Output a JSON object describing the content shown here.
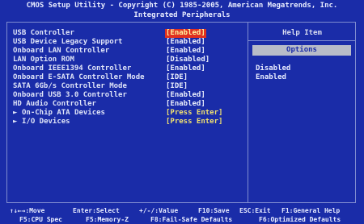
{
  "header": {
    "title": "CMOS Setup Utility - Copyright (C) 1985-2005, American Megatrends, Inc.",
    "subtitle": "Integrated Peripherals"
  },
  "settings": [
    {
      "label": "USB Controller",
      "value": "[Enabled]",
      "selected": true
    },
    {
      "label": "USB Device Legacy Support",
      "value": "[Enabled]"
    },
    {
      "label": "Onboard LAN Controller",
      "value": "[Enabled]"
    },
    {
      "label": "LAN Option ROM",
      "value": "[Disabled]"
    },
    {
      "label": "Onboard IEEE1394 Controller",
      "value": "[Enabled]"
    },
    {
      "label": "Onboard E-SATA Controller Mode",
      "value": "[IDE]"
    },
    {
      "label": "SATA 6Gb/s Controller Mode",
      "value": "[IDE]"
    },
    {
      "label": "Onboard USB 3.0 Controller",
      "value": "[Enabled]"
    },
    {
      "label": "HD Audio Controller",
      "value": "[Enabled]"
    },
    {
      "label": "On-Chip ATA Devices",
      "value": "[Press Enter]",
      "submenu": true
    },
    {
      "label": "I/O Devices",
      "value": "[Press Enter]",
      "submenu": true
    }
  ],
  "help": {
    "title": "Help Item",
    "options_label": "Options",
    "options": [
      "Disabled",
      "Enabled"
    ]
  },
  "footer": {
    "line1": [
      "↑↓←→:Move",
      "Enter:Select",
      "+/-/:Value",
      "F10:Save",
      "ESC:Exit",
      "F1:General Help"
    ],
    "line2": [
      "F5:CPU Spec",
      "F5:Memory-Z",
      "F8:Fail-Safe Defaults",
      "F6:Optimized Defaults"
    ]
  },
  "colors": {
    "background": "#1a2ca8",
    "selected_bg": "#e03020",
    "submenu_value": "#f0e070"
  }
}
